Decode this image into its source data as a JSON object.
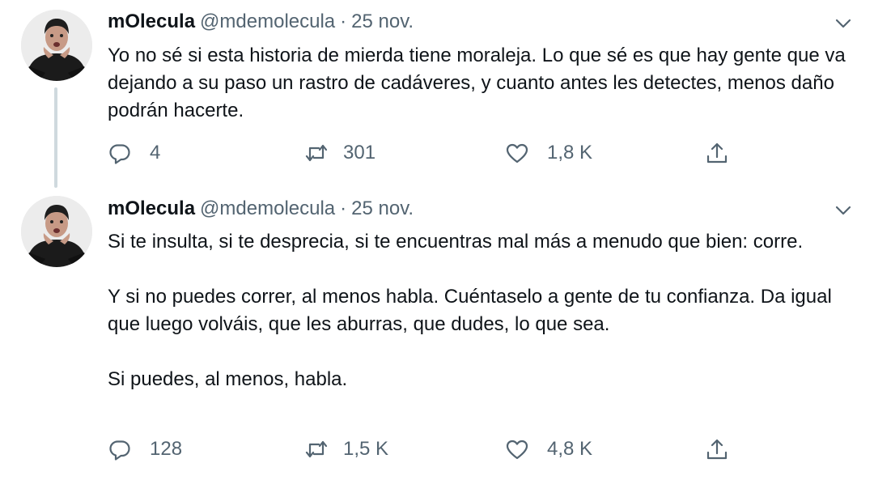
{
  "tweets": [
    {
      "display_name": "mOlecula",
      "handle": "@mdemolecula",
      "separator": "·",
      "date": "25 nov.",
      "paragraphs": [
        "Yo no sé si esta historia de mierda tiene moraleja. Lo que sé es que hay gente que va dejando a su paso un rastro de cadáveres, y cuanto antes les detectes, menos daño podrán hacerte."
      ],
      "replies": "4",
      "retweets": "301",
      "likes": "1,8 K"
    },
    {
      "display_name": "mOlecula",
      "handle": "@mdemolecula",
      "separator": "·",
      "date": "25 nov.",
      "paragraphs": [
        "Si te insulta, si te desprecia, si te encuentras mal más a menudo que bien: corre.",
        "Y si no puedes correr, al menos habla. Cuéntaselo a gente de tu confianza. Da igual que luego volváis, que les aburras, que dudes, lo que sea.",
        "Si puedes, al menos, habla."
      ],
      "replies": "128",
      "retweets": "1,5 K",
      "likes": "4,8 K"
    }
  ],
  "icons": {
    "reply": "reply-icon",
    "retweet": "retweet-icon",
    "like": "heart-icon",
    "share": "share-icon",
    "caret": "chevron-down-icon"
  },
  "colors": {
    "text": "#0f1419",
    "secondary": "#536471",
    "thread_line": "#cfd9de"
  }
}
